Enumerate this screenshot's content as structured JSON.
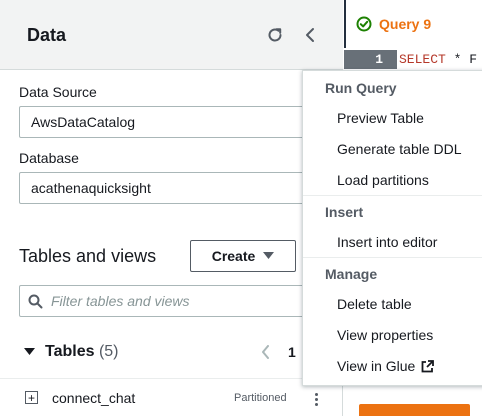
{
  "panel": {
    "title": "Data",
    "data_source_label": "Data Source",
    "data_source_value": "AwsDataCatalog",
    "database_label": "Database",
    "database_value": "acathenaquicksight",
    "tables_section_title": "Tables and views",
    "create_button_label": "Create",
    "filter_placeholder": "Filter tables and views",
    "tables_label": "Tables",
    "tables_count": "(5)",
    "page_number": "1",
    "tables": [
      {
        "name": "connect_chat",
        "badge": "Partitioned"
      }
    ]
  },
  "editor": {
    "tab_label": "Query 9",
    "line_number": "1",
    "code_keyword": "SELECT",
    "code_rest": " * F"
  },
  "menu": {
    "groups": [
      {
        "title": "Run Query",
        "items": [
          "Preview Table",
          "Generate table DDL",
          "Load partitions"
        ]
      },
      {
        "title": "Insert",
        "items": [
          "Insert into editor"
        ]
      },
      {
        "title": "Manage",
        "items": [
          "Delete table",
          "View properties",
          "View in Glue"
        ]
      }
    ]
  },
  "colors": {
    "accent": "#ec7211",
    "success": "#1d8102",
    "text": "#16191f",
    "muted": "#545b64"
  }
}
